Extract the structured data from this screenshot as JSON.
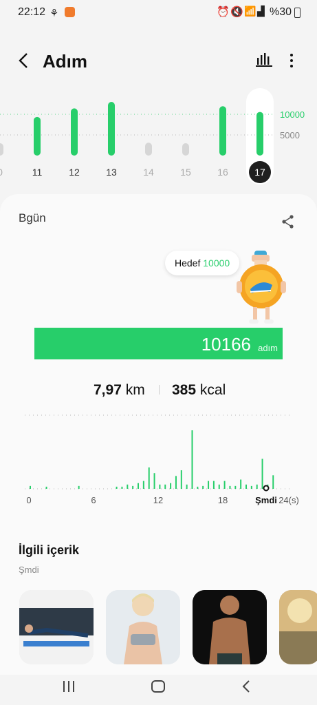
{
  "status": {
    "time": "22:12",
    "battery": "%30"
  },
  "header": {
    "title": "Adım",
    "icons": [
      "back-arrow-icon",
      "bar-chart-icon",
      "more-vertical-icon"
    ]
  },
  "week_chart": {
    "type": "bar",
    "categories": [
      "0",
      "11",
      "12",
      "13",
      "14",
      "15",
      "16",
      "17"
    ],
    "values": [
      2500,
      9000,
      11000,
      12500,
      3000,
      2800,
      11500,
      10166
    ],
    "active": [
      false,
      true,
      true,
      true,
      false,
      false,
      true,
      true
    ],
    "selected": "17",
    "goal_label": "10000",
    "mid_label": "5000"
  },
  "card": {
    "title": "Bgün",
    "goal_prefix": "Hedef",
    "goal_value": "10000",
    "steps": "10166",
    "steps_unit": "adım",
    "distance_value": "7,97",
    "distance_unit": "km",
    "calories_value": "385",
    "calories_unit": "kcal"
  },
  "chart_data": {
    "type": "bar",
    "x_ticks": [
      "0",
      "6",
      "12",
      "18",
      "Şmdi",
      "24(s)"
    ],
    "x": [
      0,
      0.5,
      1,
      1.5,
      2,
      2.5,
      3,
      3.5,
      4,
      4.5,
      5,
      5.5,
      6,
      6.5,
      7,
      7.5,
      8,
      8.5,
      9,
      9.5,
      10,
      10.5,
      11,
      11.5,
      12,
      12.5,
      13,
      13.5,
      14,
      14.5,
      15,
      15.5,
      16,
      16.5,
      17,
      17.5,
      18,
      18.5,
      19,
      19.5,
      20,
      20.5,
      21,
      21.5,
      22,
      22.5
    ],
    "values": [
      40,
      0,
      0,
      30,
      0,
      0,
      0,
      0,
      0,
      40,
      0,
      0,
      0,
      0,
      0,
      0,
      30,
      30,
      60,
      40,
      80,
      110,
      300,
      220,
      60,
      60,
      80,
      180,
      260,
      60,
      820,
      30,
      40,
      110,
      110,
      60,
      110,
      40,
      40,
      130,
      60,
      40,
      60,
      420,
      60,
      190
    ]
  },
  "related": {
    "title": "İlgili içerik",
    "subtitle": "Şmdi"
  }
}
